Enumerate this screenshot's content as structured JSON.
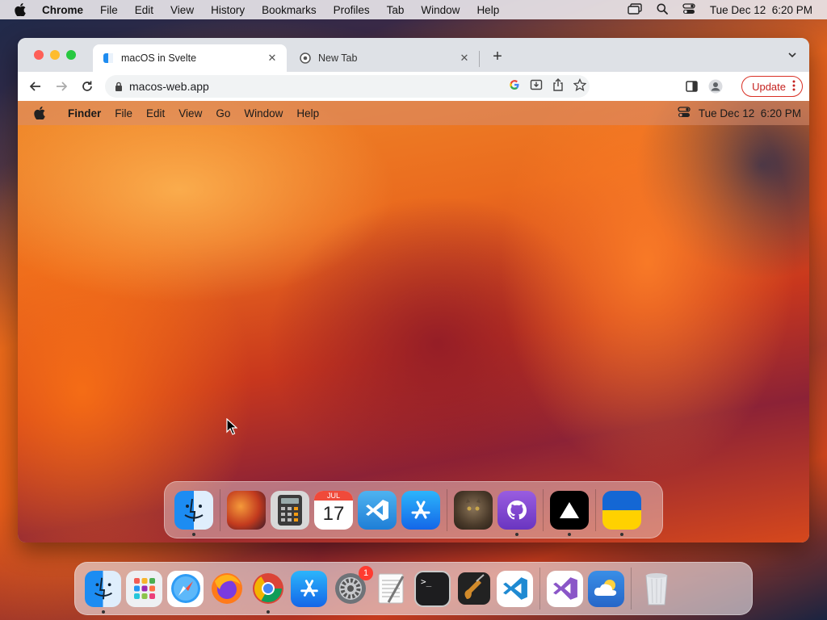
{
  "menubar": {
    "app_name": "Chrome",
    "items": [
      "File",
      "Edit",
      "View",
      "History",
      "Bookmarks",
      "Profiles",
      "Tab",
      "Window",
      "Help"
    ],
    "clock": "Tue Dec 12  6:20 PM"
  },
  "browser": {
    "tabs": [
      {
        "title": "macOS in Svelte",
        "active": true
      },
      {
        "title": "New Tab",
        "active": false
      }
    ],
    "address": "macos-web.app",
    "update_label": "Update"
  },
  "inner_site": {
    "menubar": {
      "app_name": "Finder",
      "items": [
        "File",
        "Edit",
        "View",
        "Go",
        "Window",
        "Help"
      ],
      "clock": "Tue Dec 12  6:20 PM"
    },
    "dock_apps": [
      {
        "name": "finder-icon",
        "running": true
      },
      {
        "name": "wallpapers-icon",
        "running": false
      },
      {
        "name": "calculator-icon",
        "running": false
      },
      {
        "name": "calendar-icon",
        "running": false,
        "month": "JUL",
        "day": "17"
      },
      {
        "name": "vscode-icon",
        "running": false
      },
      {
        "name": "app-store-icon",
        "running": false
      },
      {
        "name": "cat-photo-icon",
        "running": false
      },
      {
        "name": "github-icon",
        "running": true
      },
      {
        "name": "vercel-icon",
        "running": true
      },
      {
        "name": "ukraine-flag-icon",
        "running": true
      }
    ]
  },
  "dock_apps": [
    {
      "name": "finder-icon",
      "running": true
    },
    {
      "name": "launchpad-icon",
      "running": false
    },
    {
      "name": "safari-icon",
      "running": false
    },
    {
      "name": "firefox-icon",
      "running": false
    },
    {
      "name": "chrome-icon",
      "running": true
    },
    {
      "name": "app-store-icon",
      "running": false
    },
    {
      "name": "system-preferences-icon",
      "running": false,
      "badge": "1"
    },
    {
      "name": "textedit-icon",
      "running": false
    },
    {
      "name": "terminal-icon",
      "running": false
    },
    {
      "name": "garageband-icon",
      "running": false
    },
    {
      "name": "vscode-icon",
      "running": false
    },
    {
      "name": "visual-studio-icon",
      "running": false
    },
    {
      "name": "weather-icon",
      "running": false
    },
    {
      "name": "trash-icon",
      "running": false
    }
  ],
  "colors": {
    "accent_red": "#d93025",
    "traffic_red": "#fe5f57",
    "traffic_yellow": "#febc2e",
    "traffic_green": "#28c840"
  }
}
